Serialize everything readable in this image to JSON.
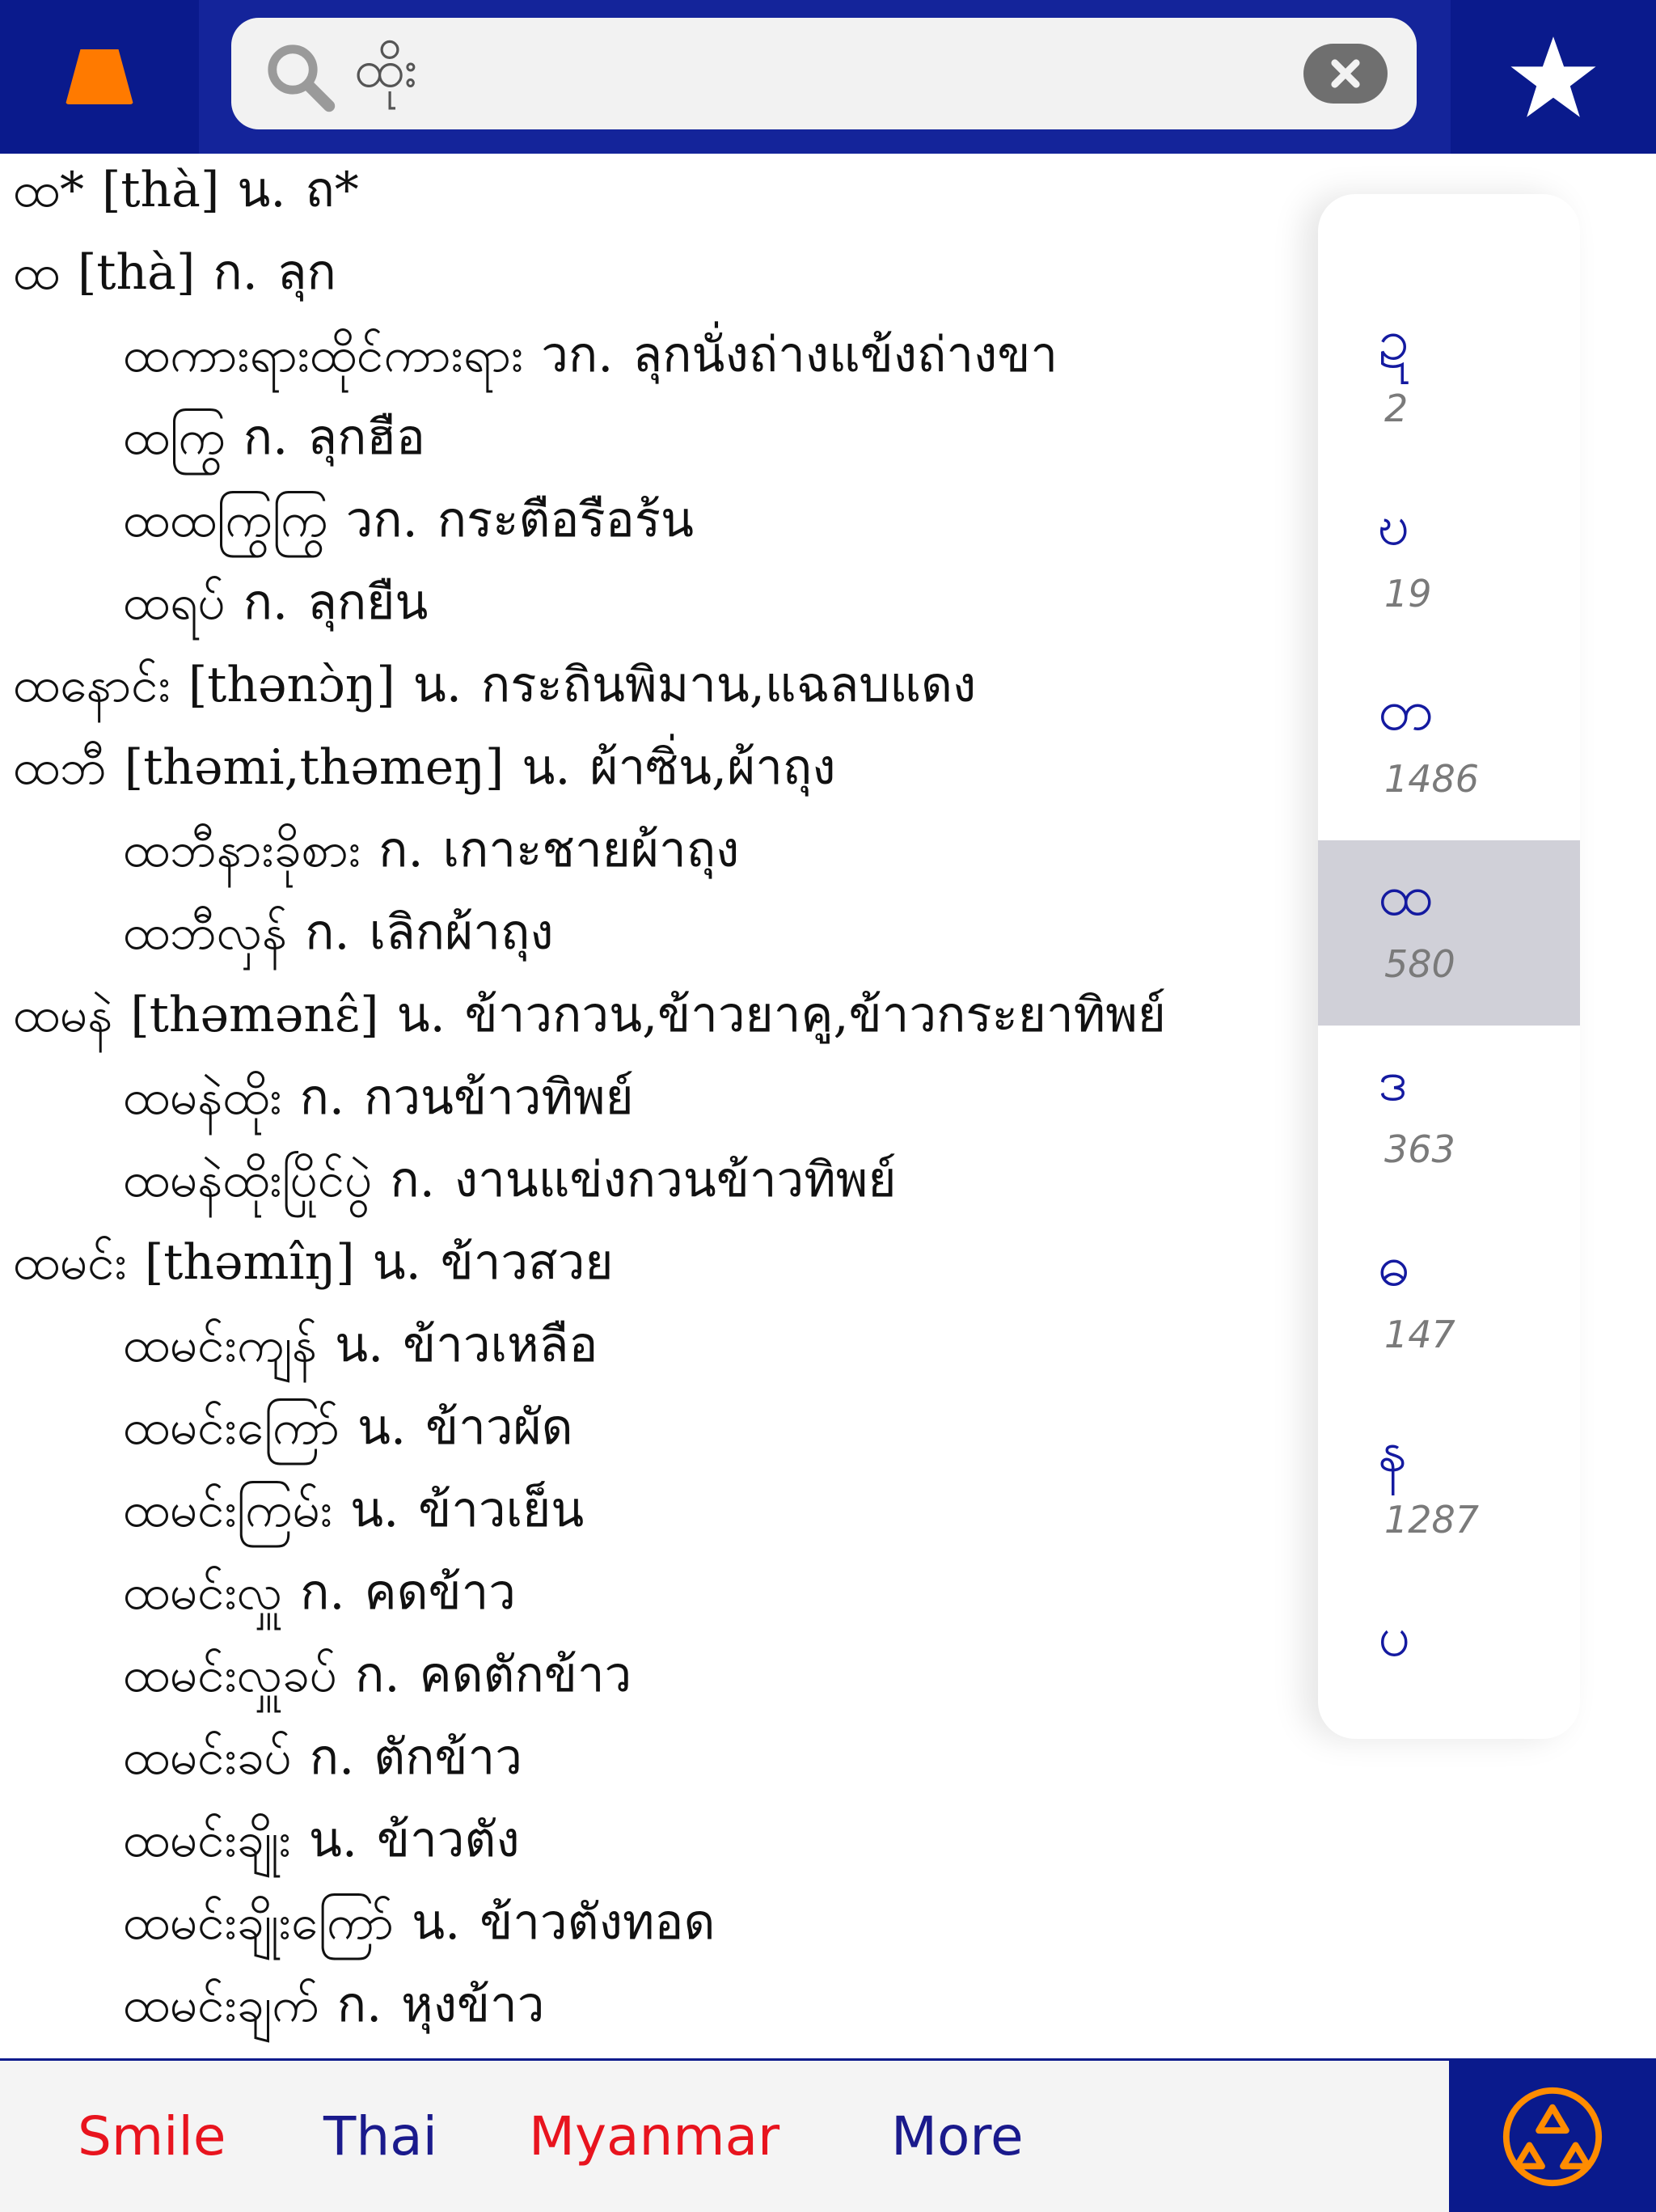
{
  "search": {
    "value": "ထိုး",
    "placeholder": ""
  },
  "entries": [
    {
      "head": "ထ*",
      "pron": "[thà]",
      "pos": "น.",
      "def": "ถ*",
      "sub": false
    },
    {
      "head": "ထ",
      "pron": "[thà]",
      "pos": "ก.",
      "def": "ลุก",
      "sub": false
    },
    {
      "head": "ထကားရားထိုင်ကားရား",
      "pron": "",
      "pos": "วก.",
      "def": "ลุกนั่งถ่างแข้งถ่างขา",
      "sub": true
    },
    {
      "head": "ထကြွ",
      "pron": "",
      "pos": "ก.",
      "def": "ลุกฮือ",
      "sub": true
    },
    {
      "head": "ထထကြွကြွ",
      "pron": "",
      "pos": "วก.",
      "def": "กระตือรือร้น",
      "sub": true
    },
    {
      "head": "ထရပ်",
      "pron": "",
      "pos": "ก.",
      "def": "ลุกยืน",
      "sub": true
    },
    {
      "head": "ထနောင်း",
      "pron": "[thənɔ̀ŋ]",
      "pos": "น.",
      "def": "กระถินพิมาน,แฉลบแดง",
      "sub": false
    },
    {
      "head": "ထဘီ",
      "pron": "[thəmi,thəmeŋ]",
      "pos": "น.",
      "def": "ผ้าซิ่น,ผ้าถุง",
      "sub": false
    },
    {
      "head": "ထဘီနားခိုစား",
      "pron": "",
      "pos": "ก.",
      "def": "เกาะชายผ้าถุง",
      "sub": true
    },
    {
      "head": "ထဘီလှန်",
      "pron": "",
      "pos": "ก.",
      "def": "เลิกผ้าถุง",
      "sub": true
    },
    {
      "head": "ထမနဲ",
      "pron": "[thəmənɛ̂]",
      "pos": "น.",
      "def": "ข้าวกวน,ข้าวยาคู,ข้าวกระยาทิพย์",
      "sub": false
    },
    {
      "head": "ထမနဲထိုး",
      "pron": "",
      "pos": "ก.",
      "def": "กวนข้าวทิพย์",
      "sub": true
    },
    {
      "head": "ထမနဲထိုးပြိုင်ပွဲ",
      "pron": "",
      "pos": "ก.",
      "def": "งานแข่งกวนข้าวทิพย์",
      "sub": true
    },
    {
      "head": "ထမင်း",
      "pron": "[thəmîŋ]",
      "pos": "น.",
      "def": "ข้าวสวย",
      "sub": false
    },
    {
      "head": "ထမင်းကျန်",
      "pron": "",
      "pos": "น.",
      "def": "ข้าวเหลือ",
      "sub": true
    },
    {
      "head": "ထမင်းကြော်",
      "pron": "",
      "pos": "น.",
      "def": "ข้าวผัด",
      "sub": true
    },
    {
      "head": "ထမင်းကြမ်း",
      "pron": "",
      "pos": "น.",
      "def": "ข้าวเย็น",
      "sub": true
    },
    {
      "head": "ထမင်းလှူ",
      "pron": "",
      "pos": "ก.",
      "def": "คดข้าว",
      "sub": true
    },
    {
      "head": "ထမင်းလှူခပ်",
      "pron": "",
      "pos": "ก.",
      "def": "คดตักข้าว",
      "sub": true
    },
    {
      "head": "ထမင်းခပ်",
      "pron": "",
      "pos": "ก.",
      "def": "ตักข้าว",
      "sub": true
    },
    {
      "head": "ထမင်းချိုး",
      "pron": "",
      "pos": "น.",
      "def": "ข้าวตัง",
      "sub": true
    },
    {
      "head": "ထမင်းချိုးကြော်",
      "pron": "",
      "pos": "น.",
      "def": "ข้าวตังทอด",
      "sub": true
    },
    {
      "head": "ထမင်းချက်",
      "pron": "",
      "pos": "ก.",
      "def": "หุงข้าว",
      "sub": true
    }
  ],
  "index": [
    {
      "letter": "ဍ",
      "count": "2",
      "selected": false
    },
    {
      "letter": "ဎ",
      "count": "19",
      "selected": false
    },
    {
      "letter": "တ",
      "count": "1486",
      "selected": false
    },
    {
      "letter": "ထ",
      "count": "580",
      "selected": true
    },
    {
      "letter": "ဒ",
      "count": "363",
      "selected": false
    },
    {
      "letter": "ဓ",
      "count": "147",
      "selected": false
    },
    {
      "letter": "န",
      "count": "1287",
      "selected": false
    },
    {
      "letter": "ပ",
      "count": "",
      "selected": false
    }
  ],
  "tabs": [
    {
      "label": "Smile",
      "color": "#e8141e"
    },
    {
      "label": "Thai",
      "color": "#1a1a8c"
    },
    {
      "label": "Myanmar",
      "color": "#e8141e"
    },
    {
      "label": "More",
      "color": "#1a1a8c"
    }
  ],
  "colors": {
    "bar": "#0a1a8c",
    "accent": "#ff7a00",
    "index_text": "#141aa0"
  },
  "icons": {
    "home": "home-icon",
    "search": "search-icon",
    "clear": "clear-icon",
    "star": "star-icon",
    "recycle": "recycle-icon"
  }
}
